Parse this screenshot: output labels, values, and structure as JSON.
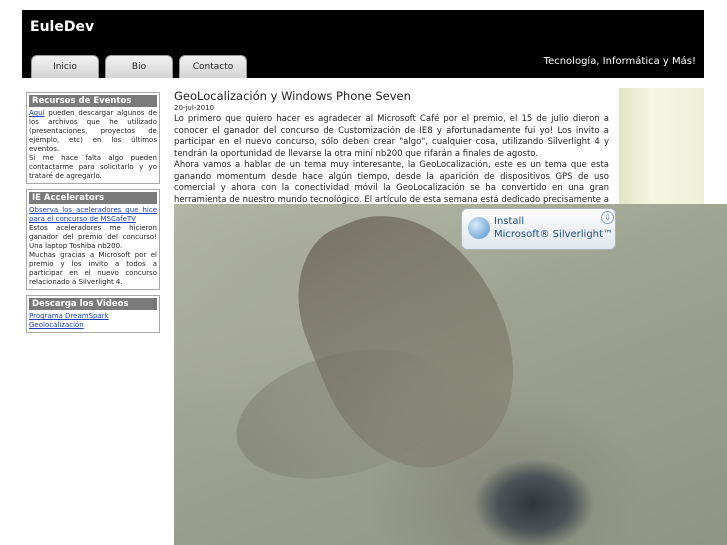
{
  "header": {
    "title": "EuleDev",
    "tagline": "Tecnología, Informática y Más!",
    "tabs": [
      {
        "label": "Inicio"
      },
      {
        "label": "Bio"
      },
      {
        "label": "Contacto"
      }
    ]
  },
  "sidebar": {
    "boxes": [
      {
        "title": "Recursos de Eventos",
        "link": "Aquí",
        "text": " pueden descargar algunos de los archivos que he utilizado (presentaciones, proyectos de ejemplo, etc) en los últimos eventos.",
        "text2": "Si me hace falta algo pueden contactarme para solicitarlo y yo trataré de agregarlo."
      },
      {
        "title": "IE Accelerators",
        "link": "Observa los aceleradores que hice para el concurso de MSCafeTV",
        "text": "Estos aceleradores me hicieron ganador del premio del concurso! Una laptop Toshiba nb200.",
        "text2": "Muchas gracias a Microsoft por el premio y los invito a todos a participar en el nuevo concurso relacionado a Silverlight 4."
      },
      {
        "title": "Descarga los Videos",
        "links": [
          "Programa DreamSpark",
          "Geolocalización"
        ]
      }
    ]
  },
  "post": {
    "title": "GeoLocalización y Windows Phone Seven",
    "date": "20-jul-2010",
    "paragraph1": "Lo primero que quiero hacer es agradecer al Microsoft Café por el premio, el 15 de julio dieron a conocer el ganador del concurso de Customización de IE8 y afortunadamente fui yo! Los invito a participar en el nuevo concurso, sólo deben crear \"algo\", cualquier cosa, utilizando Silverlight 4 y tendrán la oportunidad de llevarse la otra mini nb200 que rifarán a finales de agosto.",
    "paragraph2": "Ahora vamos a hablar de un tema muy interesante, la GeoLocalización, este es un tema que esta ganando momentum desde hace algún tiempo, desde la aparición de dispositivos GPS de uso comercial y ahora con la conectividad móvil la GeoLocalización se ha convertido en una gran herramienta de nuestro mundo tecnológico. El artículo de esta semana está dedicado precisamente a como podemos incorporar esta"
  },
  "silverlight": {
    "line1": "Install",
    "line2": "Microsoft® Silverlight™",
    "arrow": "⇩"
  },
  "colors": {
    "header_bg": "#000000",
    "box_title_bg": "#7a7a7a",
    "link": "#1a3fbf"
  }
}
